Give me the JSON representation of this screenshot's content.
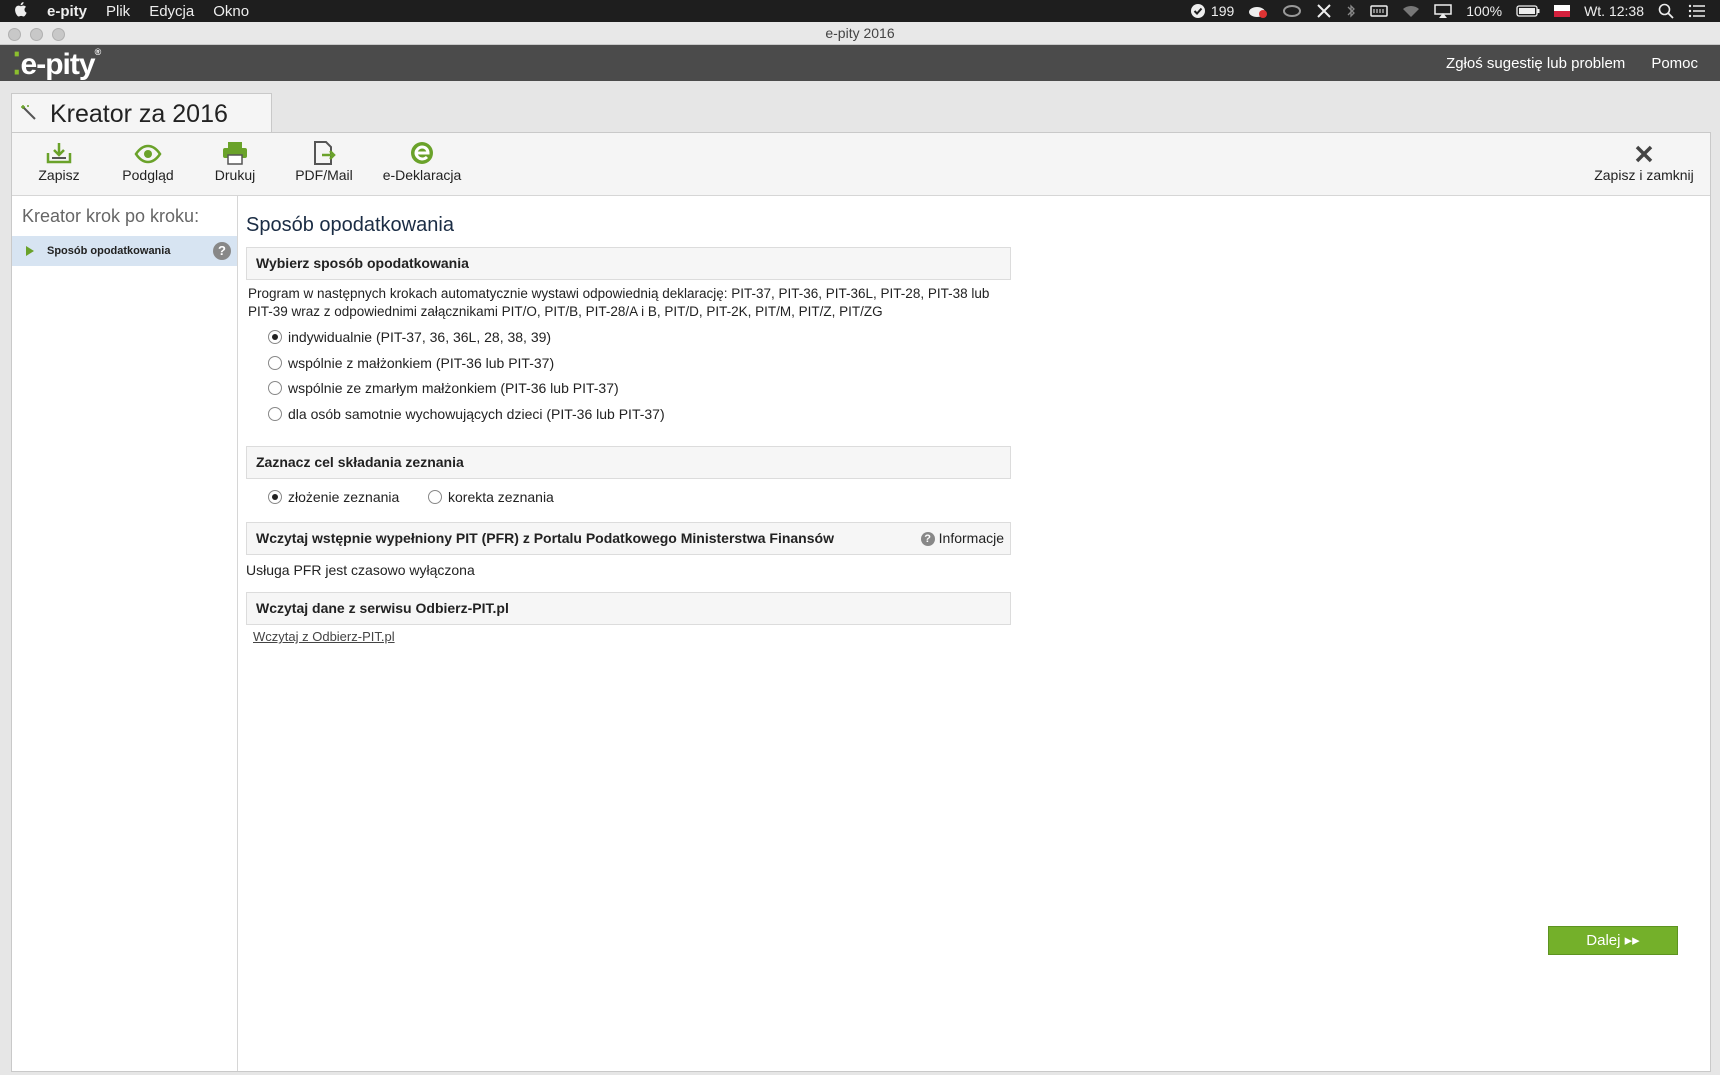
{
  "menubar": {
    "apple": "",
    "app_name": "e-pity",
    "menus": [
      "Plik",
      "Edycja",
      "Okno"
    ],
    "status_count": "199",
    "battery": "100%",
    "clock": "Wt. 12:38"
  },
  "window": {
    "title": "e-pity 2016"
  },
  "header": {
    "logo_text": "e-pity",
    "logo_mark": "®",
    "report_link": "Zgłoś sugestię lub problem",
    "help_link": "Pomoc"
  },
  "tab": {
    "title": "Kreator za 2016"
  },
  "toolbar": {
    "save": "Zapisz",
    "preview": "Podgląd",
    "print": "Drukuj",
    "pdf_mail": "PDF/Mail",
    "e_declaration": "e-Deklaracja",
    "save_close": "Zapisz i zamknij"
  },
  "sidebar": {
    "title": "Kreator krok po kroku:",
    "items": [
      {
        "label": "Sposób opodatkowania",
        "help": "?"
      }
    ]
  },
  "main": {
    "page_title": "Sposób opodatkowania",
    "section1": {
      "title": "Wybierz sposób opodatkowania",
      "description": "Program w następnych krokach automatycznie wystawi odpowiednią deklarację: PIT-37, PIT-36, PIT-36L, PIT-28, PIT-38 lub PIT-39 wraz z odpowiednimi załącznikami PIT/O, PIT/B, PIT-28/A i B, PIT/D, PIT-2K, PIT/M, PIT/Z, PIT/ZG",
      "options": [
        {
          "label": "indywidualnie (PIT-37, 36, 36L, 28, 38, 39)",
          "selected": true
        },
        {
          "label": "wspólnie z małżonkiem (PIT-36 lub PIT-37)",
          "selected": false
        },
        {
          "label": "wspólnie ze zmarłym małżonkiem (PIT-36 lub PIT-37)",
          "selected": false
        },
        {
          "label": "dla osób samotnie wychowujących dzieci (PIT-36 lub PIT-37)",
          "selected": false
        }
      ]
    },
    "section2": {
      "title": "Zaznacz cel składania zeznania",
      "options": [
        {
          "label": "złożenie zeznania",
          "selected": true
        },
        {
          "label": "korekta zeznania",
          "selected": false
        }
      ]
    },
    "section3": {
      "title": "Wczytaj wstępnie wypełniony PIT (PFR) z Portalu Podatkowego Ministerstwa Finansów",
      "info_label": "Informacje",
      "info_icon": "?",
      "status": "Usługa PFR jest czasowo wyłączona"
    },
    "section4": {
      "title": "Wczytaj dane z serwisu Odbierz-PIT.pl",
      "link": "Wczytaj z Odbierz-PIT.pl"
    }
  },
  "footer": {
    "next": "Dalej ▸▸"
  },
  "colors": {
    "accent": "#74b02a",
    "header": "#4b4b4b",
    "selected_row": "#d7e4f2"
  }
}
